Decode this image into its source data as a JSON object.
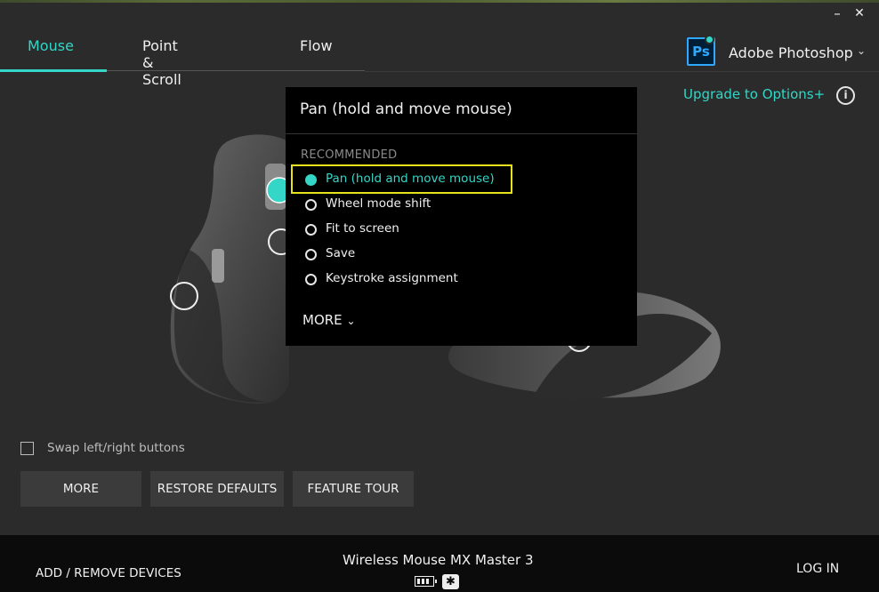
{
  "window": {
    "minimize_icon": "minimize-icon",
    "close_icon": "close-icon"
  },
  "tabs": [
    {
      "label": "Mouse",
      "active": true
    },
    {
      "label": "Point & Scroll",
      "active": false
    },
    {
      "label": "Flow",
      "active": false
    }
  ],
  "app_selector": {
    "icon_label": "Ps",
    "name": "Adobe Photoshop",
    "chevron": "⌄"
  },
  "upgrade": {
    "label": "Upgrade to Options+",
    "info_glyph": "i"
  },
  "menu": {
    "title": "Pan (hold and move mouse)",
    "section": "RECOMMENDED",
    "options": [
      {
        "label": "Pan (hold and move mouse)",
        "selected": true
      },
      {
        "label": "Wheel mode shift",
        "selected": false
      },
      {
        "label": "Fit to screen",
        "selected": false
      },
      {
        "label": "Save",
        "selected": false
      },
      {
        "label": "Keystroke assignment",
        "selected": false
      }
    ],
    "more_label": "MORE",
    "more_chevron": "⌄"
  },
  "swap": {
    "label": "Swap left/right buttons",
    "checked": false
  },
  "buttons": {
    "more": "MORE",
    "restore": "RESTORE DEFAULTS",
    "tour": "FEATURE TOUR"
  },
  "footer": {
    "add_remove": "ADD / REMOVE DEVICES",
    "device_name": "Wireless Mouse MX Master 3",
    "login": "LOG IN",
    "connection_glyph": "✱"
  },
  "colors": {
    "accent": "#33d6c7",
    "highlight": "#e8e21c",
    "background": "#2b2b2b",
    "footer": "#0b0b0b"
  }
}
